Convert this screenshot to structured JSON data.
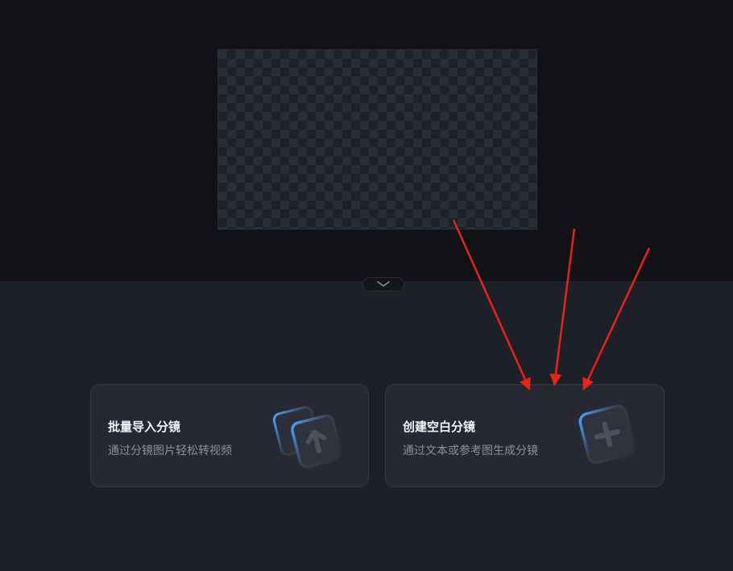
{
  "bottom_panel": {
    "cards": [
      {
        "title": "批量导入分镜",
        "description": "通过分镜图片轻松转视频",
        "icon": "upload-images-icon"
      },
      {
        "title": "创建空白分镜",
        "description": "通过文本或参考图生成分镜",
        "icon": "add-blank-icon"
      }
    ]
  },
  "collapse_toggle": {
    "icon": "chevron-down-icon"
  },
  "annotation": {
    "color": "#e8231a",
    "arrows": 3
  }
}
